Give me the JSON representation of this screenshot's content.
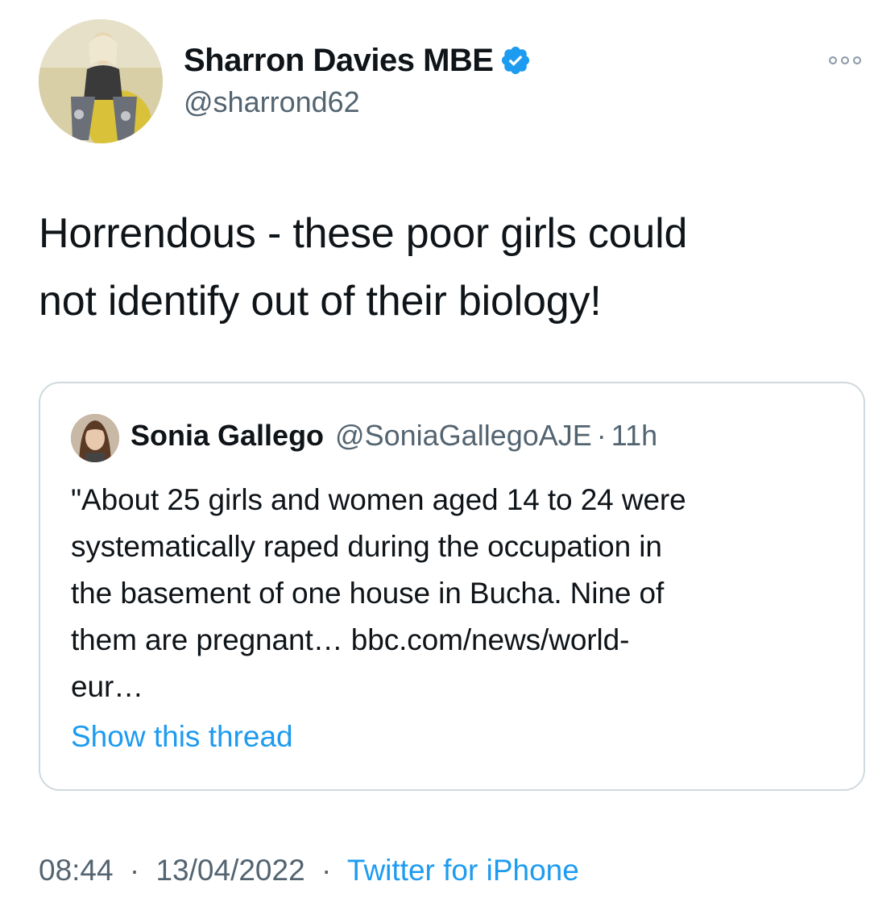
{
  "author": {
    "name": "Sharron Davies MBE",
    "handle": "@sharrond62",
    "verified": true,
    "avatar_icon": "profile-photo"
  },
  "more_icon": "more-horizontal-icon",
  "tweet": {
    "text_lines": [
      "Horrendous - these poor girls could",
      "not identify out of their biology!"
    ]
  },
  "quoted_tweet": {
    "name": "Sonia Gallego",
    "handle": "@SoniaGallegoAJE",
    "separator": "·",
    "time": "11h",
    "text_lines": [
      "\"About 25 girls and women aged 14 to 24 were",
      "systematically raped during the occupation in",
      "the basement of one house in Bucha. Nine of",
      "them are pregnant… bbc.com/news/world-",
      "eur…"
    ],
    "show_thread": "Show this thread"
  },
  "meta": {
    "time": "08:44",
    "separator": "·",
    "date": "13/04/2022",
    "source": "Twitter for iPhone"
  },
  "colors": {
    "link": "#1d9bf0",
    "secondary_text": "#536471",
    "border": "#cfd9de",
    "verified": "#1d9bf0"
  }
}
